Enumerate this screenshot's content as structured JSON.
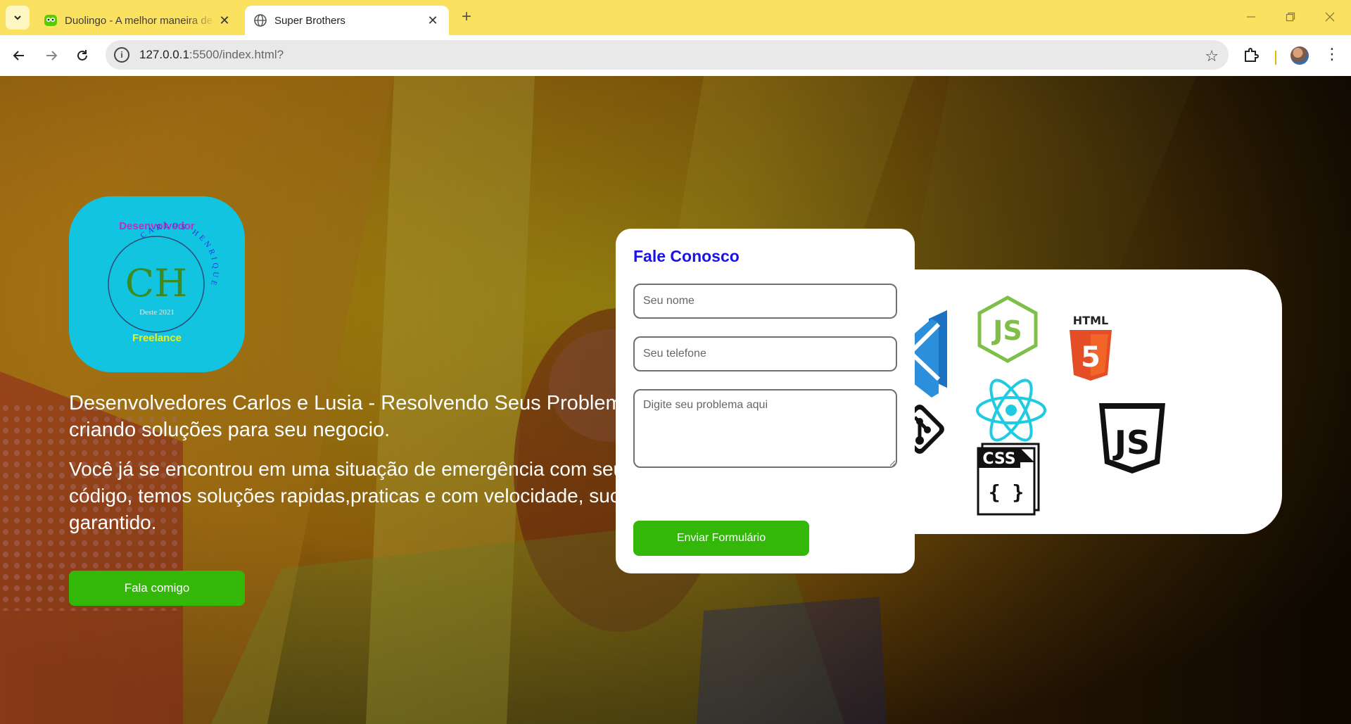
{
  "browser": {
    "tabs": [
      {
        "title": "Duolingo - A melhor maneira de aprender um idioma!",
        "favicon": "duolingo-owl-icon",
        "active": false
      },
      {
        "title": "Super Brothers",
        "favicon": "globe-icon",
        "active": true
      }
    ],
    "url_host": "127.0.0.1",
    "url_rest": ":5500/index.html?",
    "accent_color": "#fbe160"
  },
  "hero": {
    "logo": {
      "top_text": "Desenvolvedor",
      "arc_text": "CARLOS HENRIQUE",
      "monogram": "CH",
      "since": "Deste 2021",
      "bottom_text": "Freelance"
    },
    "headline": {
      "line1": "Desenvolvedores Carlos e Lusia - Resolvendo Seus Problemas e",
      "line2": "criando soluções para seu negocio."
    },
    "subline": {
      "line1": "Você já se encontrou em uma situação de emergência com seu",
      "line2": "código, temos soluções rapidas,praticas e com velocidade, sucesso",
      "line3": "garantido."
    },
    "cta_label": "Fala comigo"
  },
  "form": {
    "title": "Fale Conosco",
    "name_placeholder": "Seu nome",
    "phone_placeholder": "Seu telefone",
    "message_placeholder": "Digite seu problema aqui",
    "submit_label": "Enviar Formulário"
  },
  "tech_icons": {
    "items": [
      "vscode-icon",
      "nodejs-icon",
      "html5-icon",
      "git-icon",
      "react-icon",
      "css-icon",
      "javascript-icon"
    ],
    "html_label": "HTML",
    "html_number": "5",
    "css_label": "CSS",
    "js_label": "JS",
    "node_label": "JS",
    "css_braces": "{ }"
  },
  "colors": {
    "logo_bg": "#13c4e0",
    "form_title": "#1a12e8",
    "button_green": "#33b80a"
  }
}
